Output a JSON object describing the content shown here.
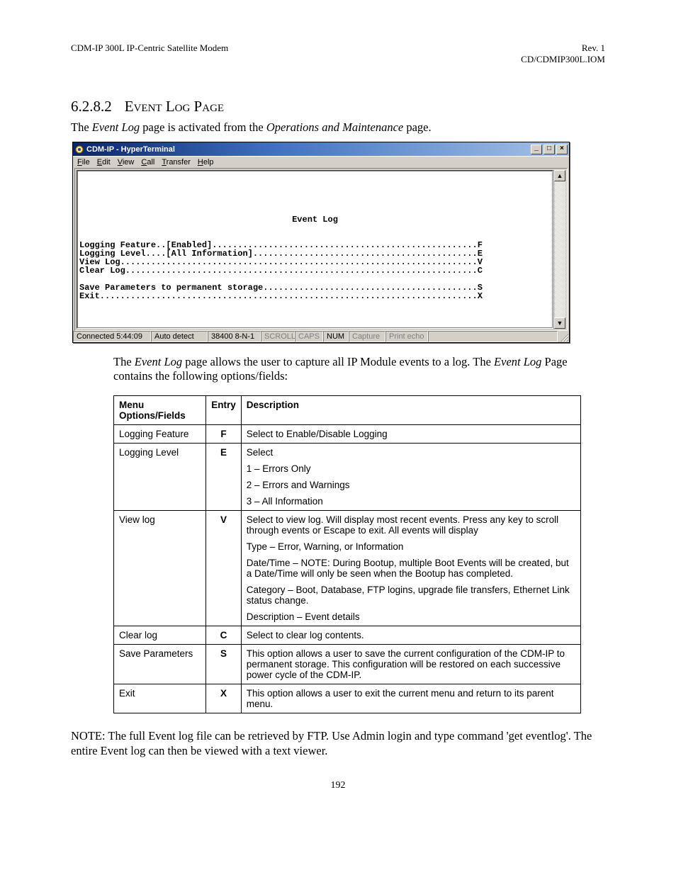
{
  "header": {
    "left": "CDM-IP 300L IP-Centric Satellite Modem",
    "right1": "Rev. 1",
    "right2": "CD/CDMIP300L.IOM"
  },
  "section": {
    "number": "6.2.8.2",
    "title": "Event Log Page"
  },
  "intro": {
    "prefix": "The ",
    "em1": "Event Log",
    "mid": " page is activated from the ",
    "em2": "Operations and Maintenance",
    "suffix": " page."
  },
  "hyper": {
    "title": "CDM-IP - HyperTerminal",
    "menu": [
      "File",
      "Edit",
      "View",
      "Call",
      "Transfer",
      "Help"
    ],
    "term_title": "Event Log",
    "lines": [
      "Logging Feature..[Enabled]....................................................F",
      "Logging Level....[All Information]............................................E",
      "View Log......................................................................V",
      "Clear Log.....................................................................C",
      "",
      "Save Parameters to permanent storage..........................................S",
      "Exit..........................................................................X"
    ],
    "status": {
      "s1": "Connected 5:44:09",
      "s2": "Auto detect",
      "s3": "38400 8-N-1",
      "s4": "SCROLL",
      "s5": "CAPS",
      "s6": "NUM",
      "s7": "Capture",
      "s8": "Print echo"
    }
  },
  "aftertext": {
    "prefix": "The ",
    "em1": "Event Log",
    "mid": " page allows the user to capture all IP Module events to a log. The ",
    "em2": "Event Log",
    "suffix": " Page contains the following options/fields:"
  },
  "table": {
    "head": {
      "c1": "Menu Options/Fields",
      "c2": "Entry",
      "c3": "Description"
    },
    "rows": [
      {
        "menu": "Logging Feature",
        "entry": "F",
        "desc": [
          "Select to Enable/Disable Logging"
        ]
      },
      {
        "menu": "Logging Level",
        "entry": "E",
        "desc": [
          "Select",
          "1 – Errors Only",
          "2 – Errors and Warnings",
          "3 – All Information"
        ]
      },
      {
        "menu": "View log",
        "entry": "V",
        "desc": [
          "Select to view log. Will display most recent events. Press any key to scroll through events or Escape to exit.  All events will display",
          "Type – Error, Warning, or Information",
          "Date/Time – NOTE: During Bootup, multiple Boot Events will be created, but a Date/Time will only be seen when the Bootup has completed.",
          "Category – Boot, Database, FTP logins, upgrade file transfers, Ethernet Link status change.",
          "Description – Event details"
        ]
      },
      {
        "menu": "Clear log",
        "entry": "C",
        "desc": [
          "Select to clear log contents."
        ]
      },
      {
        "menu": "Save Parameters",
        "entry": "S",
        "desc": [
          "This option allows a user to save the current configuration of the CDM-IP to permanent storage. This configuration will be restored on each successive power cycle of the CDM-IP."
        ]
      },
      {
        "menu": "Exit",
        "entry": "X",
        "desc": [
          "This option allows a user to exit the current menu and return to its parent menu."
        ]
      }
    ]
  },
  "note": "NOTE: The full Event log file can be retrieved by FTP.  Use Admin login and type command 'get eventlog'. The entire Event log can then be viewed with a text viewer.",
  "pagenum": "192"
}
